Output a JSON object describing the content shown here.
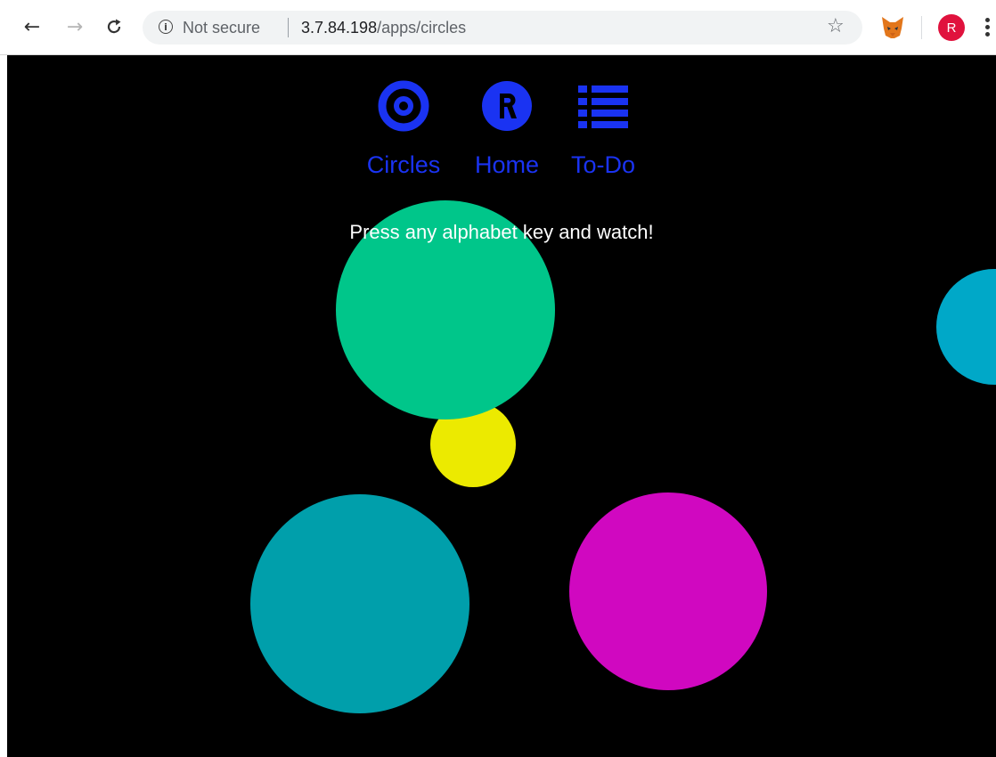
{
  "browser": {
    "back_icon": "arrow-left-icon",
    "forward_icon": "arrow-right-icon",
    "reload_icon": "reload-icon",
    "security_icon": "info-icon",
    "security_label": "Not secure",
    "url_host": "3.7.84.198",
    "url_path": "/apps/circles",
    "bookmark_icon": "star-outline-icon",
    "extension_icon": "metamask-fox-icon",
    "profile_initial": "R",
    "menu_icon": "vertical-dots-icon"
  },
  "nav": {
    "items": [
      {
        "label": "Circles",
        "icon": "target-circle-icon"
      },
      {
        "label": "Home",
        "icon": "r-badge-icon",
        "badge_text": "R"
      },
      {
        "label": "To-Do",
        "icon": "list-icon"
      }
    ],
    "accent": "#1a33f2"
  },
  "instruction": "Press any alphabet key and watch!",
  "circles": [
    {
      "color": "#00c68a"
    },
    {
      "color": "#00a8c8"
    },
    {
      "color": "#ecea00"
    },
    {
      "color": "#009fab"
    },
    {
      "color": "#d008c0"
    }
  ],
  "colors": {
    "canvas_background": "#000000",
    "profile": "#e0123d",
    "instruction_text": "#ffffff"
  }
}
